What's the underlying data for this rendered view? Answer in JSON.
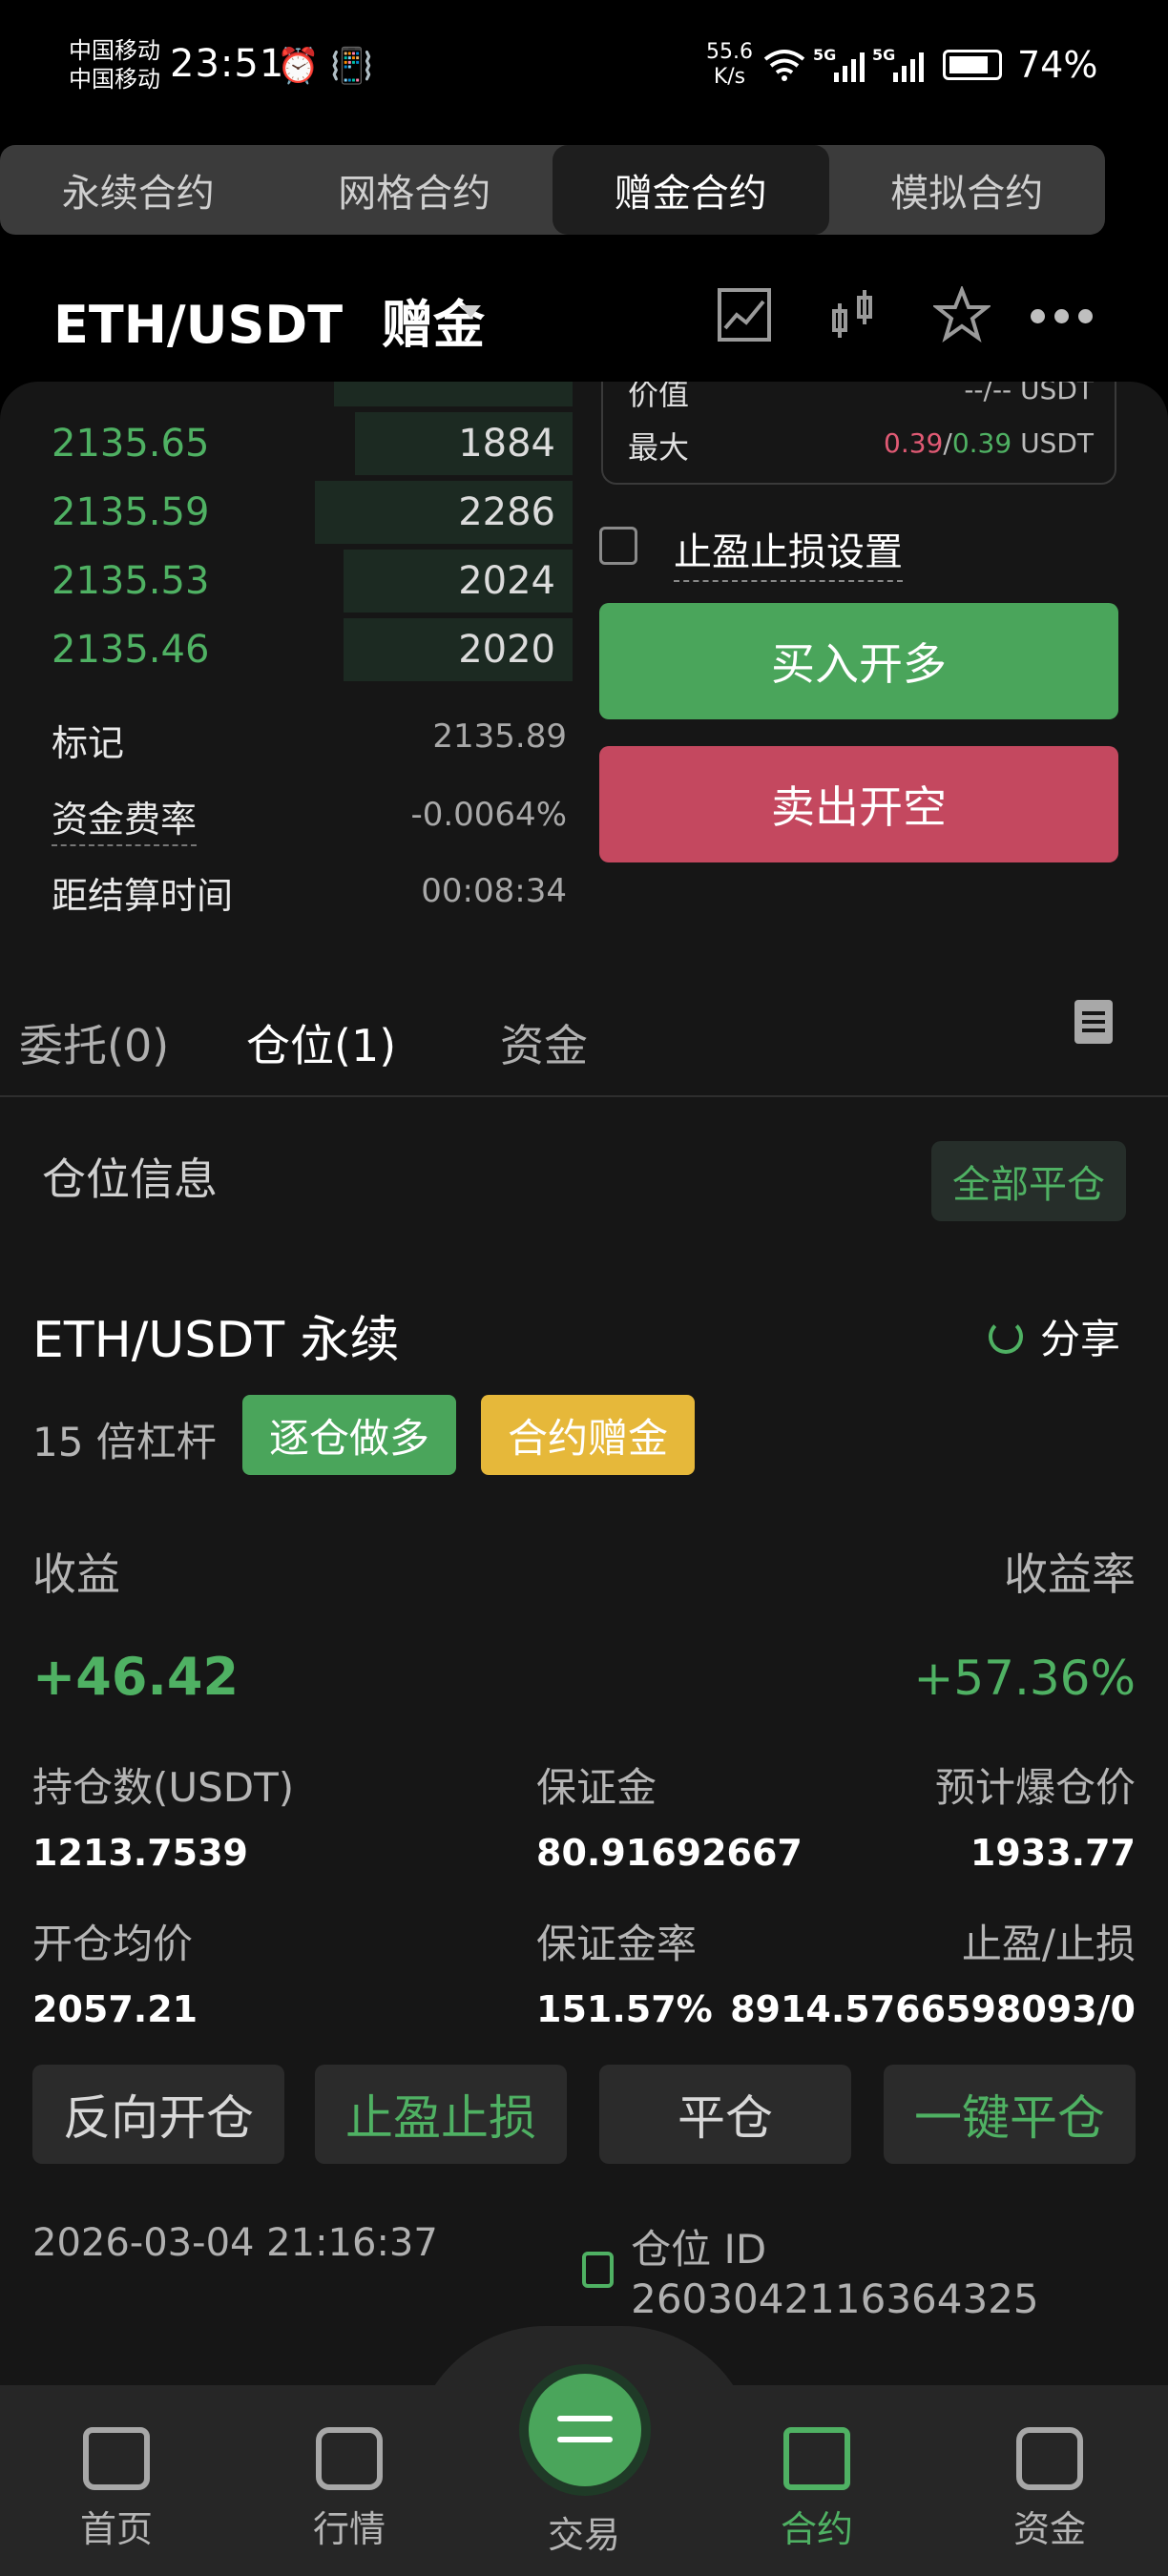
{
  "status_bar": {
    "carrier1": "中国移动",
    "carrier2": "中国移动",
    "time": "23:51",
    "net_speed_value": "55.6",
    "net_speed_unit": "K/s",
    "signal1": "5G",
    "signal2": "5G",
    "battery": "74%"
  },
  "contract_tabs": [
    "永续合约",
    "网格合约",
    "赠金合约",
    "模拟合约"
  ],
  "header": {
    "pair": "ETH/USDT",
    "mode": "赠金"
  },
  "order_book": [
    {
      "price": "2135.65",
      "qty": "1884",
      "depth": 0.38
    },
    {
      "price": "2135.59",
      "qty": "2286",
      "depth": 0.45
    },
    {
      "price": "2135.53",
      "qty": "2024",
      "depth": 0.4
    },
    {
      "price": "2135.46",
      "qty": "2020",
      "depth": 0.4
    }
  ],
  "stats": {
    "mark_label": "标记",
    "mark_value": "2135.89",
    "funding_label": "资金费率",
    "funding_value": "-0.0064%",
    "settle_label": "距结算时间",
    "settle_value": "00:08:34"
  },
  "value_box": {
    "value_label": "价值",
    "value_val": "--/-- USDT",
    "max_label": "最大",
    "max_a": "0.39",
    "max_sep": "/",
    "max_b": "0.39",
    "max_unit": "USDT"
  },
  "tpsl_label": "止盈止损设置",
  "buy_label": "买入开多",
  "sell_label": "卖出开空",
  "sub_tabs": {
    "orders": "委托(0)",
    "positions": "仓位(1)",
    "funds": "资金"
  },
  "position": {
    "section_title": "仓位信息",
    "close_all": "全部平仓",
    "pair": "ETH/USDT 永续",
    "share": "分享",
    "leverage": "15 倍杠杆",
    "tag_side": "逐仓做多",
    "tag_bonus": "合约赠金",
    "pnl_label": "收益",
    "pnl_value": "+46.42",
    "roe_label": "收益率",
    "roe_value": "+57.36%",
    "size_label": "持仓数(USDT)",
    "size_value": "1213.7539",
    "margin_label": "保证金",
    "margin_value": "80.91692667",
    "liq_label": "预计爆仓价",
    "liq_value": "1933.77",
    "entry_label": "开仓均价",
    "entry_value": "2057.21",
    "margin_ratio_label": "保证金率",
    "margin_ratio_value": "151.57%",
    "tpsl_label": "止盈/止损",
    "tpsl_value": "8914.5766598093/0",
    "btn_reverse": "反向开仓",
    "btn_tpsl": "止盈止损",
    "btn_close": "平仓",
    "btn_quick_close": "一键平仓",
    "opened_at": "2026-03-04 21:16:37",
    "position_id": "仓位 ID 2603042116364325"
  },
  "bottom_nav": [
    "首页",
    "行情",
    "交易",
    "合约",
    "资金"
  ],
  "colors": {
    "green": "#4fb163",
    "red": "#c4485f",
    "yellow": "#e6b83a"
  }
}
